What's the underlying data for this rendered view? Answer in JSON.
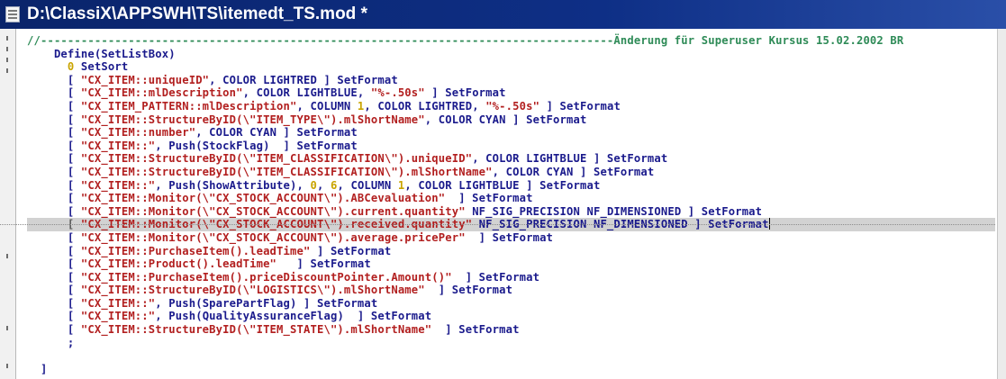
{
  "window": {
    "title": "D:\\ClassiX\\APPSWH\\TS\\itemedt_TS.mod *",
    "icon": "document-icon"
  },
  "code": {
    "lines": [
      {
        "segments": [
          [
            "cmt",
            "//-------------------------------------------------------------------------------------Änderung für Superuser Kursus 15.02.2002 BR"
          ]
        ]
      },
      {
        "segments": [
          [
            "kw",
            "    Define(SetListBox)"
          ]
        ]
      },
      {
        "segments": [
          [
            "num",
            "      0"
          ],
          [
            "kw",
            " SetSort"
          ]
        ]
      },
      {
        "segments": [
          [
            "kw",
            "      [ "
          ],
          [
            "str",
            "\"CX_ITEM::uniqueID\""
          ],
          [
            "kw",
            ", COLOR LIGHTRED ] SetFormat"
          ]
        ]
      },
      {
        "segments": [
          [
            "kw",
            "      [ "
          ],
          [
            "str",
            "\"CX_ITEM::mlDescription\""
          ],
          [
            "kw",
            ", COLOR LIGHTBLUE, "
          ],
          [
            "str",
            "\"%-.50s\""
          ],
          [
            "kw",
            " ] SetFormat"
          ]
        ]
      },
      {
        "segments": [
          [
            "kw",
            "      [ "
          ],
          [
            "str",
            "\"CX_ITEM_PATTERN::mlDescription\""
          ],
          [
            "kw",
            ", COLUMN "
          ],
          [
            "num",
            "1"
          ],
          [
            "kw",
            ", COLOR LIGHTRED, "
          ],
          [
            "str",
            "\"%-.50s\""
          ],
          [
            "kw",
            " ] SetFormat"
          ]
        ]
      },
      {
        "segments": [
          [
            "kw",
            "      [ "
          ],
          [
            "str",
            "\"CX_ITEM::StructureByID(\\\"ITEM_TYPE\\\").mlShortName\""
          ],
          [
            "kw",
            ", COLOR CYAN ] SetFormat"
          ]
        ]
      },
      {
        "segments": [
          [
            "kw",
            "      [ "
          ],
          [
            "str",
            "\"CX_ITEM::number\""
          ],
          [
            "kw",
            ", COLOR CYAN ] SetFormat"
          ]
        ]
      },
      {
        "segments": [
          [
            "kw",
            "      [ "
          ],
          [
            "str",
            "\"CX_ITEM::\""
          ],
          [
            "kw",
            ", Push(StockFlag)  ] SetFormat"
          ]
        ]
      },
      {
        "segments": [
          [
            "kw",
            "      [ "
          ],
          [
            "str",
            "\"CX_ITEM::StructureByID(\\\"ITEM_CLASSIFICATION\\\").uniqueID\""
          ],
          [
            "kw",
            ", COLOR LIGHTBLUE ] SetFormat"
          ]
        ]
      },
      {
        "segments": [
          [
            "kw",
            "      [ "
          ],
          [
            "str",
            "\"CX_ITEM::StructureByID(\\\"ITEM_CLASSIFICATION\\\").mlShortName\""
          ],
          [
            "kw",
            ", COLOR CYAN ] SetFormat"
          ]
        ]
      },
      {
        "segments": [
          [
            "kw",
            "      [ "
          ],
          [
            "str",
            "\"CX_ITEM::\""
          ],
          [
            "kw",
            ", Push(ShowAttribute), "
          ],
          [
            "num",
            "0"
          ],
          [
            "kw",
            ", "
          ],
          [
            "num",
            "6"
          ],
          [
            "kw",
            ", COLUMN "
          ],
          [
            "num",
            "1"
          ],
          [
            "kw",
            ", COLOR LIGHTBLUE ] SetFormat"
          ]
        ]
      },
      {
        "segments": [
          [
            "kw",
            "      [ "
          ],
          [
            "str",
            "\"CX_ITEM::Monitor(\\\"CX_STOCK_ACCOUNT\\\").ABCevaluation\""
          ],
          [
            "kw",
            "  ] SetFormat"
          ]
        ]
      },
      {
        "segments": [
          [
            "kw",
            "      [ "
          ],
          [
            "str",
            "\"CX_ITEM::Monitor(\\\"CX_STOCK_ACCOUNT\\\").current.quantity\""
          ],
          [
            "kw",
            " NF_SIG_PRECISION NF_DIMENSIONED ] SetFormat"
          ]
        ]
      },
      {
        "current": true,
        "segments": [
          [
            "gray",
            "      [ "
          ],
          [
            "str",
            "\"CX_ITEM::Monitor(\\\"CX_STOCK_ACCOUNT\\\").received.quantity\""
          ],
          [
            "kw",
            " NF_SIG_PRECISION NF_DIMENSIONED ] SetFormat"
          ]
        ]
      },
      {
        "segments": [
          [
            "kw",
            "      [ "
          ],
          [
            "str",
            "\"CX_ITEM::Monitor(\\\"CX_STOCK_ACCOUNT\\\").average.pricePer\""
          ],
          [
            "kw",
            "  ] SetFormat"
          ]
        ]
      },
      {
        "segments": [
          [
            "kw",
            "      [ "
          ],
          [
            "str",
            "\"CX_ITEM::PurchaseItem().leadTime\""
          ],
          [
            "kw",
            " ] SetFormat"
          ]
        ]
      },
      {
        "segments": [
          [
            "kw",
            "      [ "
          ],
          [
            "str",
            "\"CX_ITEM::Product().leadTime\""
          ],
          [
            "kw",
            "   ] SetFormat"
          ]
        ]
      },
      {
        "segments": [
          [
            "kw",
            "      [ "
          ],
          [
            "str",
            "\"CX_ITEM::PurchaseItem().priceDiscountPointer.Amount()\""
          ],
          [
            "kw",
            "  ] SetFormat"
          ]
        ]
      },
      {
        "segments": [
          [
            "kw",
            "      [ "
          ],
          [
            "str",
            "\"CX_ITEM::StructureByID(\\\"LOGISTICS\\\").mlShortName\""
          ],
          [
            "kw",
            "  ] SetFormat"
          ]
        ]
      },
      {
        "segments": [
          [
            "kw",
            "      [ "
          ],
          [
            "str",
            "\"CX_ITEM::\""
          ],
          [
            "kw",
            ", Push(SparePartFlag) ] SetFormat"
          ]
        ]
      },
      {
        "segments": [
          [
            "kw",
            "      [ "
          ],
          [
            "str",
            "\"CX_ITEM::\""
          ],
          [
            "kw",
            ", Push(QualityAssuranceFlag)  ] SetFormat"
          ]
        ]
      },
      {
        "segments": [
          [
            "kw",
            "      [ "
          ],
          [
            "str",
            "\"CX_ITEM::StructureByID(\\\"ITEM_STATE\\\").mlShortName\""
          ],
          [
            "kw",
            "  ] SetFormat"
          ]
        ]
      },
      {
        "segments": [
          [
            "kw",
            "      ;"
          ]
        ]
      },
      {
        "segments": [
          [
            "kw",
            ""
          ]
        ]
      },
      {
        "segments": [
          [
            "kw",
            "  ]"
          ]
        ]
      }
    ]
  }
}
